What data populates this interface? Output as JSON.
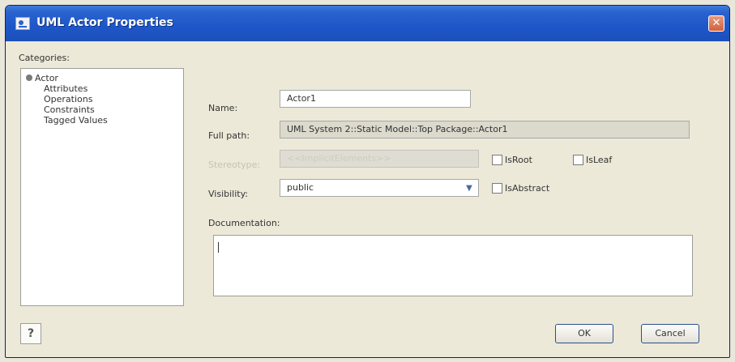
{
  "window": {
    "title": "UML Actor Properties",
    "close_glyph": "✕",
    "close_color": "#d2603b"
  },
  "categories": {
    "label": "Categories:",
    "items": [
      "Actor",
      "Attributes",
      "Operations",
      "Constraints",
      "Tagged Values"
    ]
  },
  "form": {
    "name_label": "Name:",
    "name_value": "Actor1",
    "fullpath_label": "Full path:",
    "fullpath_value": "UML System 2::Static Model::Top Package::Actor1",
    "stereotype_label": "Stereotype:",
    "stereotype_value": "<<ImplicitElements>>",
    "isroot_label": "IsRoot",
    "isleaf_label": "IsLeaf",
    "visibility_label": "Visibility:",
    "visibility_value": "public",
    "isabstract_label": "IsAbstract",
    "documentation_label": "Documentation:",
    "documentation_value": ""
  },
  "footer": {
    "help_icon": "help-icon",
    "help_glyph": "?",
    "ok_label": "OK",
    "cancel_label": "Cancel"
  },
  "colors": {
    "titlebar": "#1e56c9",
    "window_bg": "#ece9d8",
    "button_border": "#2b4e8c"
  }
}
